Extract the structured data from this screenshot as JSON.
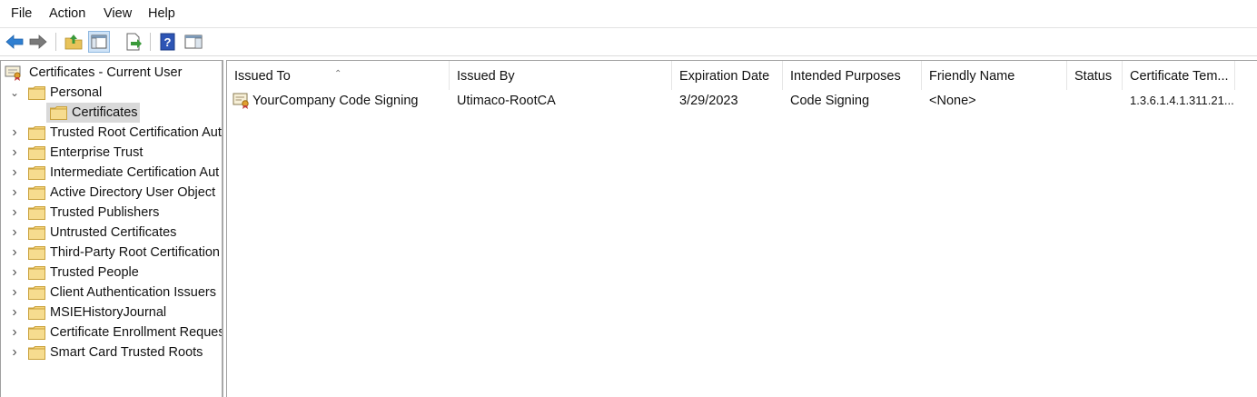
{
  "menu": {
    "file": "File",
    "action": "Action",
    "view": "View",
    "help": "Help"
  },
  "toolbar": {
    "icons": [
      "back-arrow-icon",
      "forward-arrow-icon",
      "up-folder-icon",
      "show-hide-console-tree-icon",
      "export-list-icon",
      "help-icon",
      "action-pane-icon"
    ]
  },
  "tree": {
    "root": "Certificates - Current User",
    "personal": "Personal",
    "certificates": "Certificates",
    "items": [
      "Trusted Root Certification Aut",
      "Enterprise Trust",
      "Intermediate Certification Aut",
      "Active Directory User Object",
      "Trusted Publishers",
      "Untrusted Certificates",
      "Third-Party Root Certification",
      "Trusted People",
      "Client Authentication Issuers",
      "MSIEHistoryJournal",
      "Certificate Enrollment Reques",
      "Smart Card Trusted Roots"
    ]
  },
  "list": {
    "columns": [
      "Issued To",
      "Issued By",
      "Expiration Date",
      "Intended Purposes",
      "Friendly Name",
      "Status",
      "Certificate Tem..."
    ],
    "rows": [
      [
        "YourCompany Code Signing",
        "Utimaco-RootCA",
        "3/29/2023",
        "Code Signing",
        "<None>",
        "",
        "1.3.6.1.4.1.311.21..."
      ]
    ]
  },
  "colors": {
    "folder": "#f3d27a",
    "folder_edge": "#c9a13b",
    "selected": "#d9d9d9",
    "back_arrow": "#2f7fd1"
  }
}
